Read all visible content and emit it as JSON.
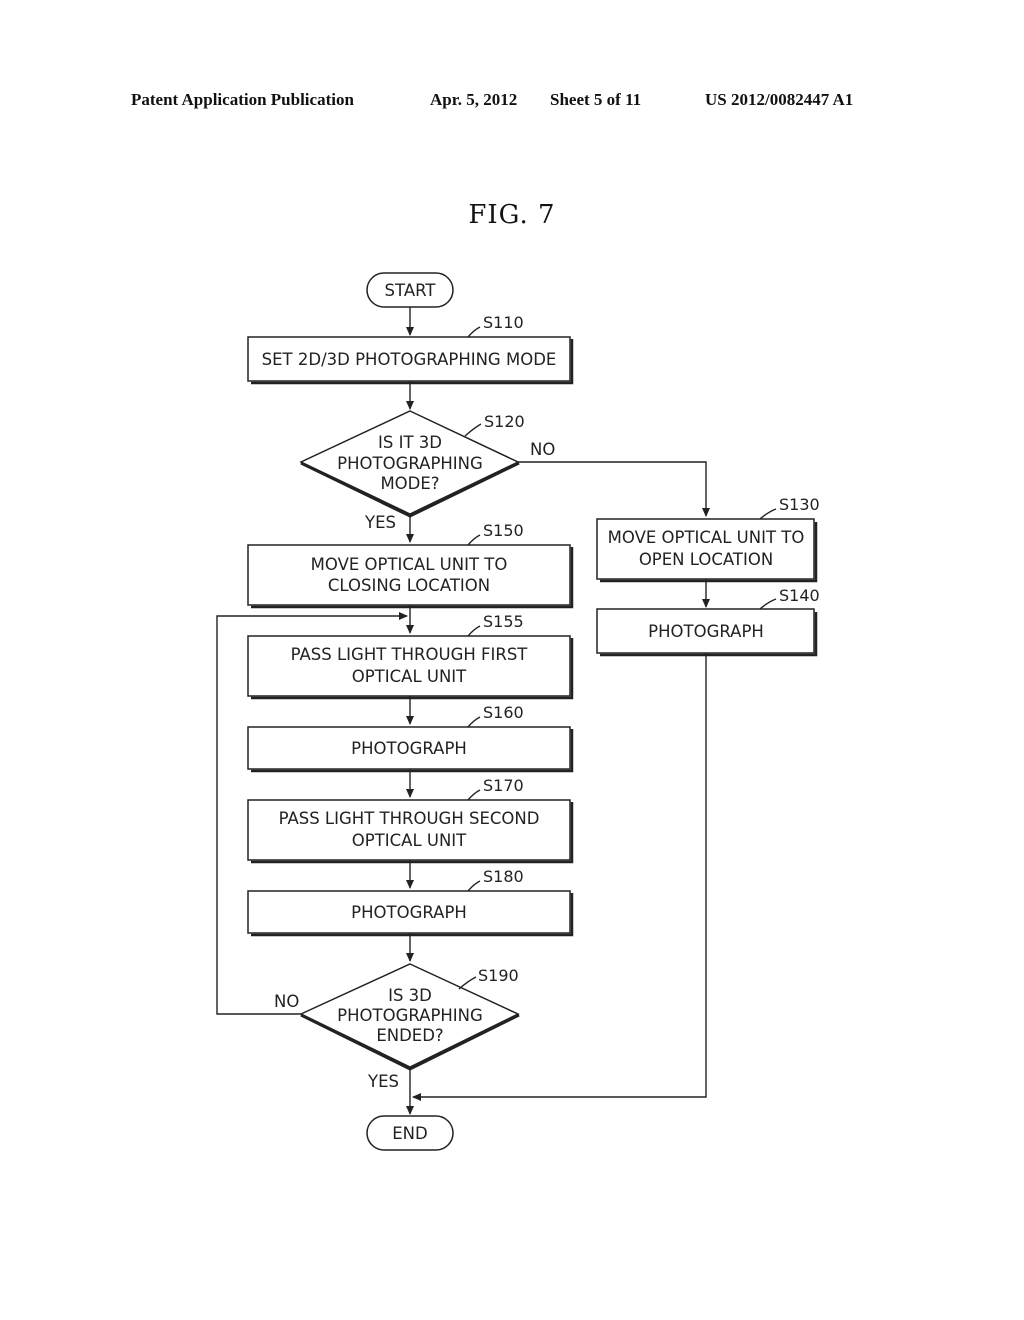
{
  "header": {
    "publication": "Patent Application Publication",
    "date": "Apr. 5, 2012",
    "sheet": "Sheet 5 of 11",
    "number": "US 2012/0082447 A1"
  },
  "figure": {
    "title": "FIG.  7"
  },
  "flowchart": {
    "start": "START",
    "end": "END",
    "steps": {
      "s110": {
        "id": "S110",
        "lines": [
          "SET 2D/3D PHOTOGRAPHING MODE"
        ]
      },
      "s120": {
        "id": "S120",
        "lines": [
          "IS IT 3D",
          "PHOTOGRAPHING",
          "MODE?"
        ],
        "yes": "YES",
        "no": "NO"
      },
      "s130": {
        "id": "S130",
        "lines": [
          "MOVE OPTICAL UNIT TO",
          "OPEN LOCATION"
        ]
      },
      "s140": {
        "id": "S140",
        "lines": [
          "PHOTOGRAPH"
        ]
      },
      "s150": {
        "id": "S150",
        "lines": [
          "MOVE OPTICAL UNIT TO",
          "CLOSING LOCATION"
        ]
      },
      "s155": {
        "id": "S155",
        "lines": [
          "PASS LIGHT THROUGH FIRST",
          "OPTICAL UNIT"
        ]
      },
      "s160": {
        "id": "S160",
        "lines": [
          "PHOTOGRAPH"
        ]
      },
      "s170": {
        "id": "S170",
        "lines": [
          "PASS LIGHT THROUGH SECOND",
          "OPTICAL UNIT"
        ]
      },
      "s180": {
        "id": "S180",
        "lines": [
          "PHOTOGRAPH"
        ]
      },
      "s190": {
        "id": "S190",
        "lines": [
          "IS 3D",
          "PHOTOGRAPHING",
          "ENDED?"
        ],
        "yes": "YES",
        "no": "NO"
      }
    }
  }
}
